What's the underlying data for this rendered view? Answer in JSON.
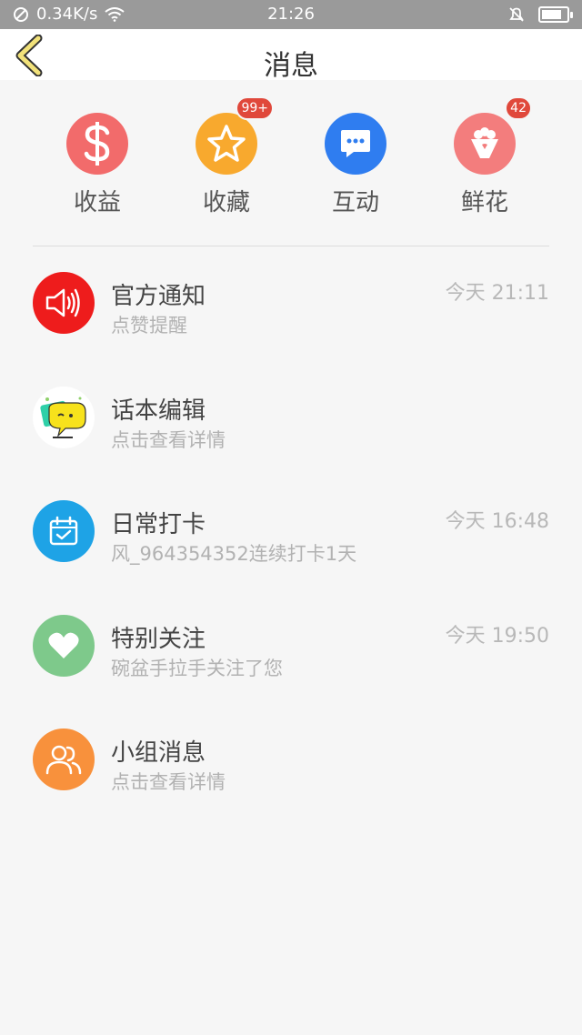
{
  "status_bar": {
    "speed": "0.34K/s",
    "time": "21:26"
  },
  "nav": {
    "title": "消息"
  },
  "top_grid": [
    {
      "label": "收益",
      "icon": "dollar-icon",
      "color": "#f26b6b",
      "badge": ""
    },
    {
      "label": "收藏",
      "icon": "star-icon",
      "color": "#f8a92e",
      "badge": "99+"
    },
    {
      "label": "互动",
      "icon": "chat-bubble-icon",
      "color": "#2f7df0",
      "badge": ""
    },
    {
      "label": "鲜花",
      "icon": "flower-bouquet-icon",
      "color": "#f37d7d",
      "badge": "42"
    }
  ],
  "messages": [
    {
      "name": "官方通知",
      "sub": "点赞提醒",
      "time": "今天 21:11",
      "icon": "speaker-icon",
      "color": "#ee1c1c"
    },
    {
      "name": "话本编辑",
      "sub": "点击查看详情",
      "time": "",
      "icon": "editor-avatar-icon",
      "color": "#ffffff"
    },
    {
      "name": "日常打卡",
      "sub": "风_964354352连续打卡1天",
      "time": "今天 16:48",
      "icon": "calendar-check-icon",
      "color": "#1ea3e6"
    },
    {
      "name": "特别关注",
      "sub": "碗盆手拉手关注了您",
      "time": "今天 19:50",
      "icon": "heart-icon",
      "color": "#7ec98b"
    },
    {
      "name": "小组消息",
      "sub": "点击查看详情",
      "time": "",
      "icon": "group-icon",
      "color": "#f8913c"
    }
  ]
}
